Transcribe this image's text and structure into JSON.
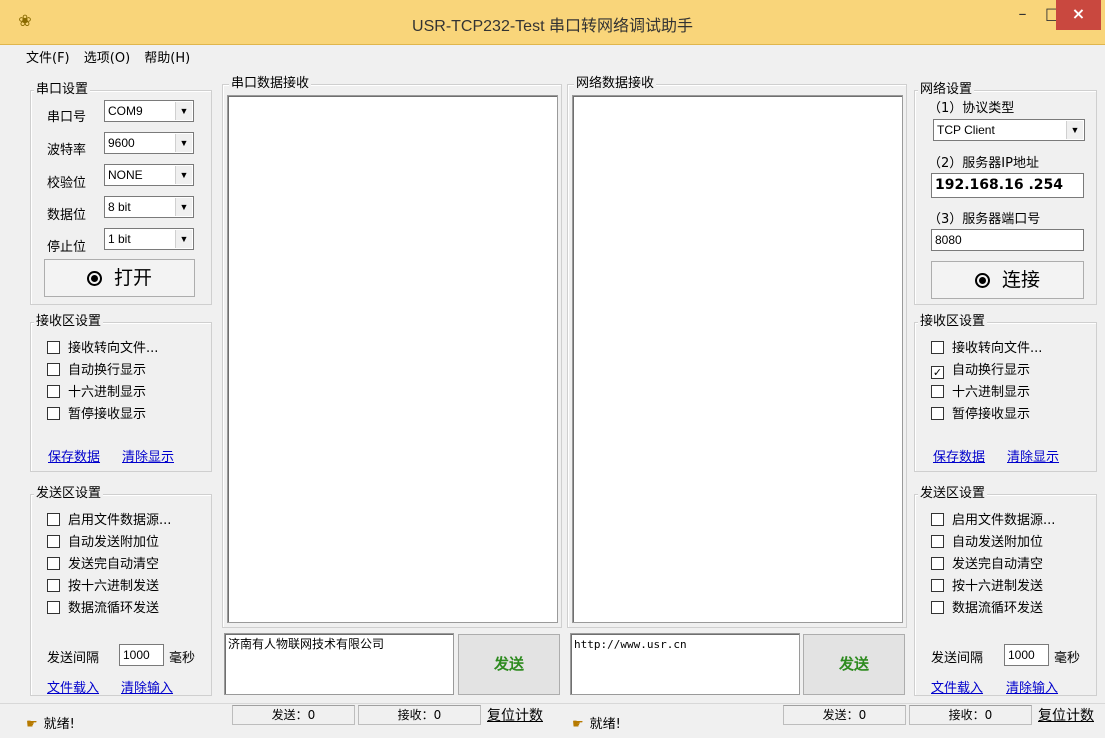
{
  "window": {
    "title": "USR-TCP232-Test 串口转网络调试助手",
    "icon": "app-icon",
    "controls": {
      "minimize": "–",
      "maximize": "□",
      "close": "×"
    }
  },
  "menu": [
    {
      "label": "文件(F)"
    },
    {
      "label": "选项(O)"
    },
    {
      "label": "帮助(H)"
    }
  ],
  "serial_settings": {
    "title": "串口设置",
    "port_label": "串口号",
    "port_value": "COM9",
    "baud_label": "波特率",
    "baud_value": "9600",
    "parity_label": "校验位",
    "parity_value": "NONE",
    "databits_label": "数据位",
    "databits_value": "8 bit",
    "stopbits_label": "停止位",
    "stopbits_value": "1 bit",
    "open_button": "打开"
  },
  "left_receive": {
    "title": "接收区设置",
    "options": [
      {
        "label": "接收转向文件...",
        "checked": false
      },
      {
        "label": "自动换行显示",
        "checked": false
      },
      {
        "label": "十六进制显示",
        "checked": false
      },
      {
        "label": "暂停接收显示",
        "checked": false
      }
    ],
    "save_link": "保存数据",
    "clear_link": "清除显示"
  },
  "left_send": {
    "title": "发送区设置",
    "options": [
      {
        "label": "启用文件数据源...",
        "checked": false
      },
      {
        "label": "自动发送附加位",
        "checked": false
      },
      {
        "label": "发送完自动清空",
        "checked": false
      },
      {
        "label": "按十六进制发送",
        "checked": false
      },
      {
        "label": "数据流循环发送",
        "checked": false
      }
    ],
    "interval_label": "发送间隔",
    "interval_value": "1000",
    "interval_unit": "毫秒",
    "load_link": "文件载入",
    "clear_link": "清除输入"
  },
  "serial_receive": {
    "title": "串口数据接收"
  },
  "network_receive": {
    "title": "网络数据接收"
  },
  "serial_send": {
    "text": "济南有人物联网技术有限公司",
    "button": "发送"
  },
  "network_send": {
    "text": "http://www.usr.cn",
    "button": "发送"
  },
  "network_settings": {
    "title": "网络设置",
    "protocol_label": "（1）协议类型",
    "protocol_value": "TCP Client",
    "ip_label": "（2）服务器IP地址",
    "ip_value": "192.168.16 .254",
    "port_label": "（3）服务器端口号",
    "port_value": "8080",
    "connect_button": "连接"
  },
  "right_receive": {
    "title": "接收区设置",
    "options": [
      {
        "label": "接收转向文件...",
        "checked": false
      },
      {
        "label": "自动换行显示",
        "checked": true
      },
      {
        "label": "十六进制显示",
        "checked": false
      },
      {
        "label": "暂停接收显示",
        "checked": false
      }
    ],
    "save_link": "保存数据",
    "clear_link": "清除显示"
  },
  "right_send": {
    "title": "发送区设置",
    "options": [
      {
        "label": "启用文件数据源...",
        "checked": false
      },
      {
        "label": "自动发送附加位",
        "checked": false
      },
      {
        "label": "发送完自动清空",
        "checked": false
      },
      {
        "label": "按十六进制发送",
        "checked": false
      },
      {
        "label": "数据流循环发送",
        "checked": false
      }
    ],
    "interval_label": "发送间隔",
    "interval_value": "1000",
    "interval_unit": "毫秒",
    "load_link": "文件载入",
    "clear_link": "清除输入"
  },
  "status_left": {
    "ready": "就绪!",
    "sent": "发送：0",
    "received": "接收：0",
    "reset": "复位计数"
  },
  "status_right": {
    "ready": "就绪!",
    "sent": "发送：0",
    "received": "接收：0",
    "reset": "复位计数"
  },
  "colors": {
    "titlebar": "#f9d57a",
    "close": "#c9483f",
    "send_text": "#2e8b20",
    "link": "#0000cc"
  }
}
